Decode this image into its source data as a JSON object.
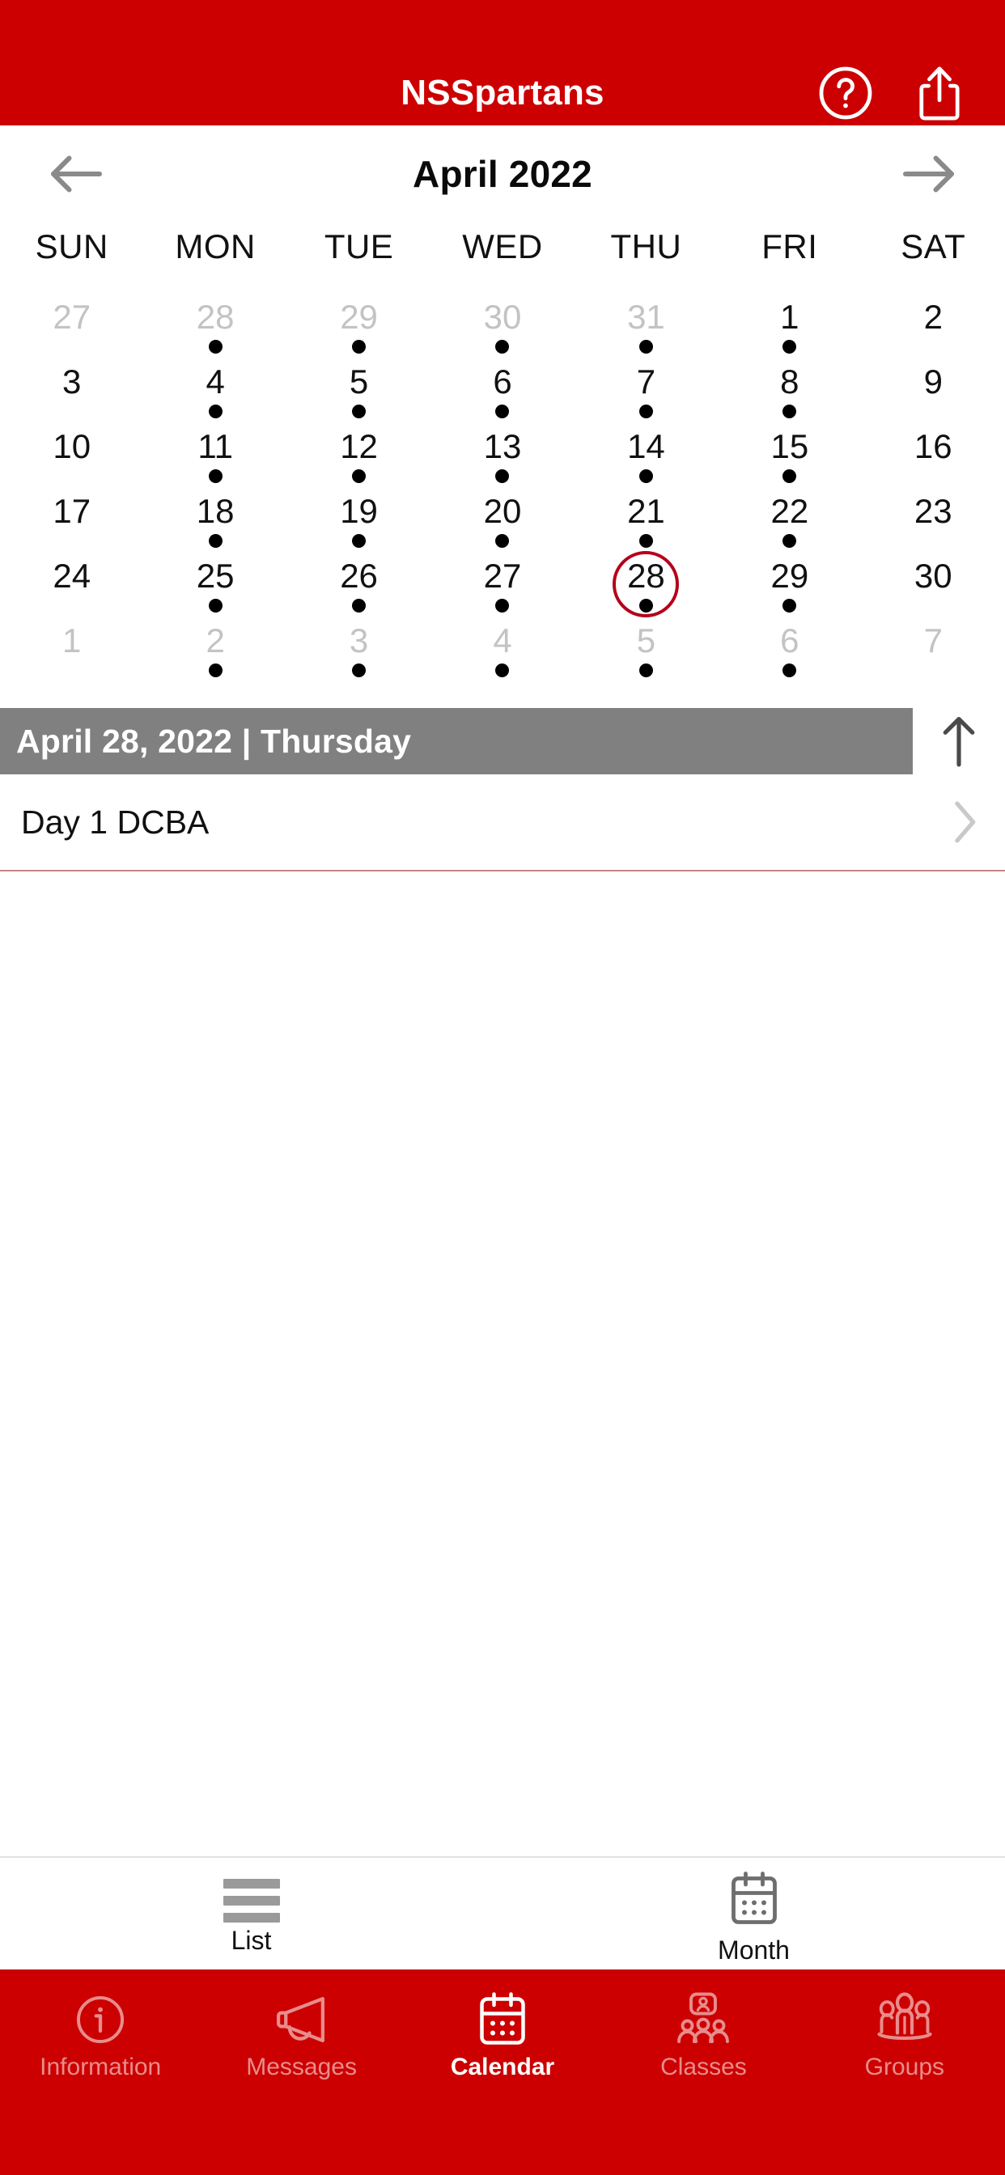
{
  "header": {
    "title": "NSSpartans",
    "help_icon": "help-circle-icon",
    "share_icon": "share-icon"
  },
  "calendar": {
    "month_title": "April 2022",
    "prev_icon": "arrow-left-icon",
    "next_icon": "arrow-right-icon",
    "weekdays": [
      "SUN",
      "MON",
      "TUE",
      "WED",
      "THU",
      "FRI",
      "SAT"
    ],
    "weeks": [
      [
        {
          "day": "27",
          "muted": true,
          "dot": false,
          "selected": false
        },
        {
          "day": "28",
          "muted": true,
          "dot": true,
          "selected": false
        },
        {
          "day": "29",
          "muted": true,
          "dot": true,
          "selected": false
        },
        {
          "day": "30",
          "muted": true,
          "dot": true,
          "selected": false
        },
        {
          "day": "31",
          "muted": true,
          "dot": true,
          "selected": false
        },
        {
          "day": "1",
          "muted": false,
          "dot": true,
          "selected": false
        },
        {
          "day": "2",
          "muted": false,
          "dot": false,
          "selected": false
        }
      ],
      [
        {
          "day": "3",
          "muted": false,
          "dot": false,
          "selected": false
        },
        {
          "day": "4",
          "muted": false,
          "dot": true,
          "selected": false
        },
        {
          "day": "5",
          "muted": false,
          "dot": true,
          "selected": false
        },
        {
          "day": "6",
          "muted": false,
          "dot": true,
          "selected": false
        },
        {
          "day": "7",
          "muted": false,
          "dot": true,
          "selected": false
        },
        {
          "day": "8",
          "muted": false,
          "dot": true,
          "selected": false
        },
        {
          "day": "9",
          "muted": false,
          "dot": false,
          "selected": false
        }
      ],
      [
        {
          "day": "10",
          "muted": false,
          "dot": false,
          "selected": false
        },
        {
          "day": "11",
          "muted": false,
          "dot": true,
          "selected": false
        },
        {
          "day": "12",
          "muted": false,
          "dot": true,
          "selected": false
        },
        {
          "day": "13",
          "muted": false,
          "dot": true,
          "selected": false
        },
        {
          "day": "14",
          "muted": false,
          "dot": true,
          "selected": false
        },
        {
          "day": "15",
          "muted": false,
          "dot": true,
          "selected": false
        },
        {
          "day": "16",
          "muted": false,
          "dot": false,
          "selected": false
        }
      ],
      [
        {
          "day": "17",
          "muted": false,
          "dot": false,
          "selected": false
        },
        {
          "day": "18",
          "muted": false,
          "dot": true,
          "selected": false
        },
        {
          "day": "19",
          "muted": false,
          "dot": true,
          "selected": false
        },
        {
          "day": "20",
          "muted": false,
          "dot": true,
          "selected": false
        },
        {
          "day": "21",
          "muted": false,
          "dot": true,
          "selected": false
        },
        {
          "day": "22",
          "muted": false,
          "dot": true,
          "selected": false
        },
        {
          "day": "23",
          "muted": false,
          "dot": false,
          "selected": false
        }
      ],
      [
        {
          "day": "24",
          "muted": false,
          "dot": false,
          "selected": false
        },
        {
          "day": "25",
          "muted": false,
          "dot": true,
          "selected": false
        },
        {
          "day": "26",
          "muted": false,
          "dot": true,
          "selected": false
        },
        {
          "day": "27",
          "muted": false,
          "dot": true,
          "selected": false
        },
        {
          "day": "28",
          "muted": false,
          "dot": true,
          "selected": true
        },
        {
          "day": "29",
          "muted": false,
          "dot": true,
          "selected": false
        },
        {
          "day": "30",
          "muted": false,
          "dot": false,
          "selected": false
        }
      ],
      [
        {
          "day": "1",
          "muted": true,
          "dot": false,
          "selected": false
        },
        {
          "day": "2",
          "muted": true,
          "dot": true,
          "selected": false
        },
        {
          "day": "3",
          "muted": true,
          "dot": true,
          "selected": false
        },
        {
          "day": "4",
          "muted": true,
          "dot": true,
          "selected": false
        },
        {
          "day": "5",
          "muted": true,
          "dot": true,
          "selected": false
        },
        {
          "day": "6",
          "muted": true,
          "dot": true,
          "selected": false
        },
        {
          "day": "7",
          "muted": true,
          "dot": false,
          "selected": false
        }
      ]
    ],
    "selected_date_label": "April 28, 2022 | Thursday",
    "collapse_icon": "arrow-up-icon"
  },
  "events": [
    {
      "title": "Day 1 DCBA",
      "chevron_icon": "chevron-right-icon"
    }
  ],
  "view_switch": [
    {
      "label": "List",
      "icon": "list-icon",
      "active": false
    },
    {
      "label": "Month",
      "icon": "calendar-icon",
      "active": true
    }
  ],
  "tabbar": [
    {
      "label": "Information",
      "icon": "info-circle-icon",
      "active": false
    },
    {
      "label": "Messages",
      "icon": "megaphone-icon",
      "active": false
    },
    {
      "label": "Calendar",
      "icon": "calendar-icon",
      "active": true
    },
    {
      "label": "Classes",
      "icon": "classes-icon",
      "active": false
    },
    {
      "label": "Groups",
      "icon": "groups-icon",
      "active": false
    }
  ],
  "colors": {
    "brand_red": "#CC0000",
    "selected_ring": "#B5001A",
    "daybar_gray": "#808080",
    "muted_text": "#C3C3C3",
    "separator": "#C58585"
  }
}
